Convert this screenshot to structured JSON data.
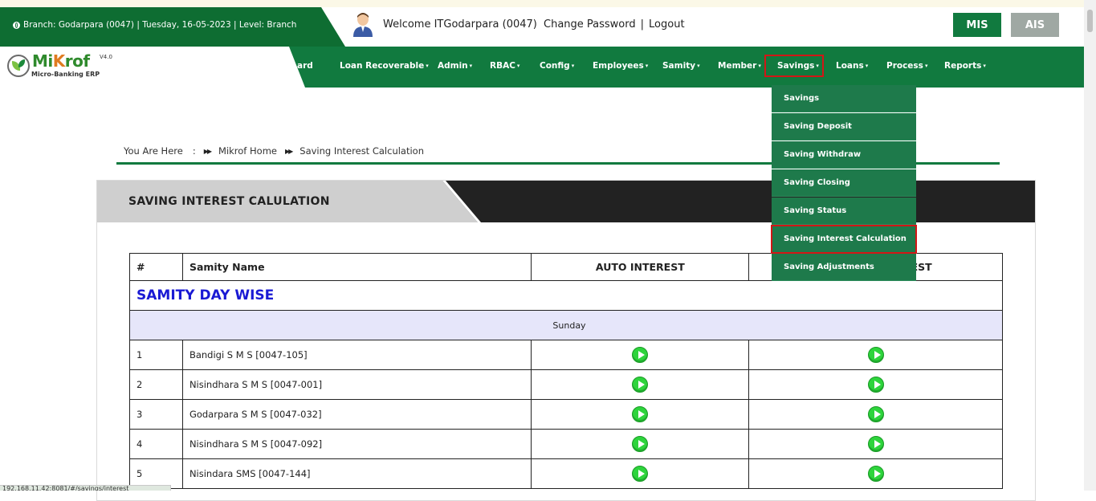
{
  "header": {
    "branch_info": "Branch: Godarpara (0047) | Tuesday, 16-05-2023 | Level: Branch",
    "welcome": "Welcome ITGodarpara (0047)",
    "change_password": "Change Password",
    "separator": "|",
    "logout": "Logout",
    "mis": "MIS",
    "ais": "AIS"
  },
  "logo": {
    "name_part1": "Mi",
    "name_part2": "K",
    "name_part3": "rof",
    "version": "V4.0",
    "subtitle": "Micro-Banking ERP"
  },
  "nav": {
    "items": [
      {
        "label": "ard",
        "caret": ""
      },
      {
        "label": "Loan Recoverable",
        "caret": "▾"
      },
      {
        "label": "Admin",
        "caret": "▾"
      },
      {
        "label": "RBAC",
        "caret": "▾"
      },
      {
        "label": "Config",
        "caret": "▾"
      },
      {
        "label": "Employees",
        "caret": "▾"
      },
      {
        "label": "Samity",
        "caret": "▾"
      },
      {
        "label": "Member",
        "caret": "▾"
      },
      {
        "label": "Savings",
        "caret": "▾"
      },
      {
        "label": "Loans",
        "caret": "▾"
      },
      {
        "label": "Process",
        "caret": "▾"
      },
      {
        "label": "Reports",
        "caret": "▾"
      }
    ]
  },
  "savings_menu": {
    "items": [
      "Savings",
      "Saving Deposit",
      "Saving Withdraw",
      "Saving Closing",
      "Saving Status",
      "Saving Interest Calculation",
      "Saving Adjustments"
    ]
  },
  "breadcrumb": {
    "you_are_here": "You Are Here",
    "colon": ":",
    "home": "Mikrof Home",
    "current": "Saving Interest Calculation"
  },
  "panel": {
    "title": "SAVING INTEREST CALULATION"
  },
  "table": {
    "headers": {
      "num": "#",
      "samity": "Samity Name",
      "auto": "AUTO INTEREST",
      "manual": "L INTEREST"
    },
    "group_label": "SAMITY DAY WISE",
    "day_label": "Sunday",
    "rows": [
      {
        "num": "1",
        "name": "Bandigi S M S [0047-105]"
      },
      {
        "num": "2",
        "name": "Nisindhara S M S [0047-001]"
      },
      {
        "num": "3",
        "name": "Godarpara S M S [0047-032]"
      },
      {
        "num": "4",
        "name": "Nisindhara S M S [0047-092]"
      },
      {
        "num": "5",
        "name": "Nisindara SMS [0047-144]"
      }
    ]
  },
  "status_bar": "192.168.11.42:8081/#/savings/interest"
}
